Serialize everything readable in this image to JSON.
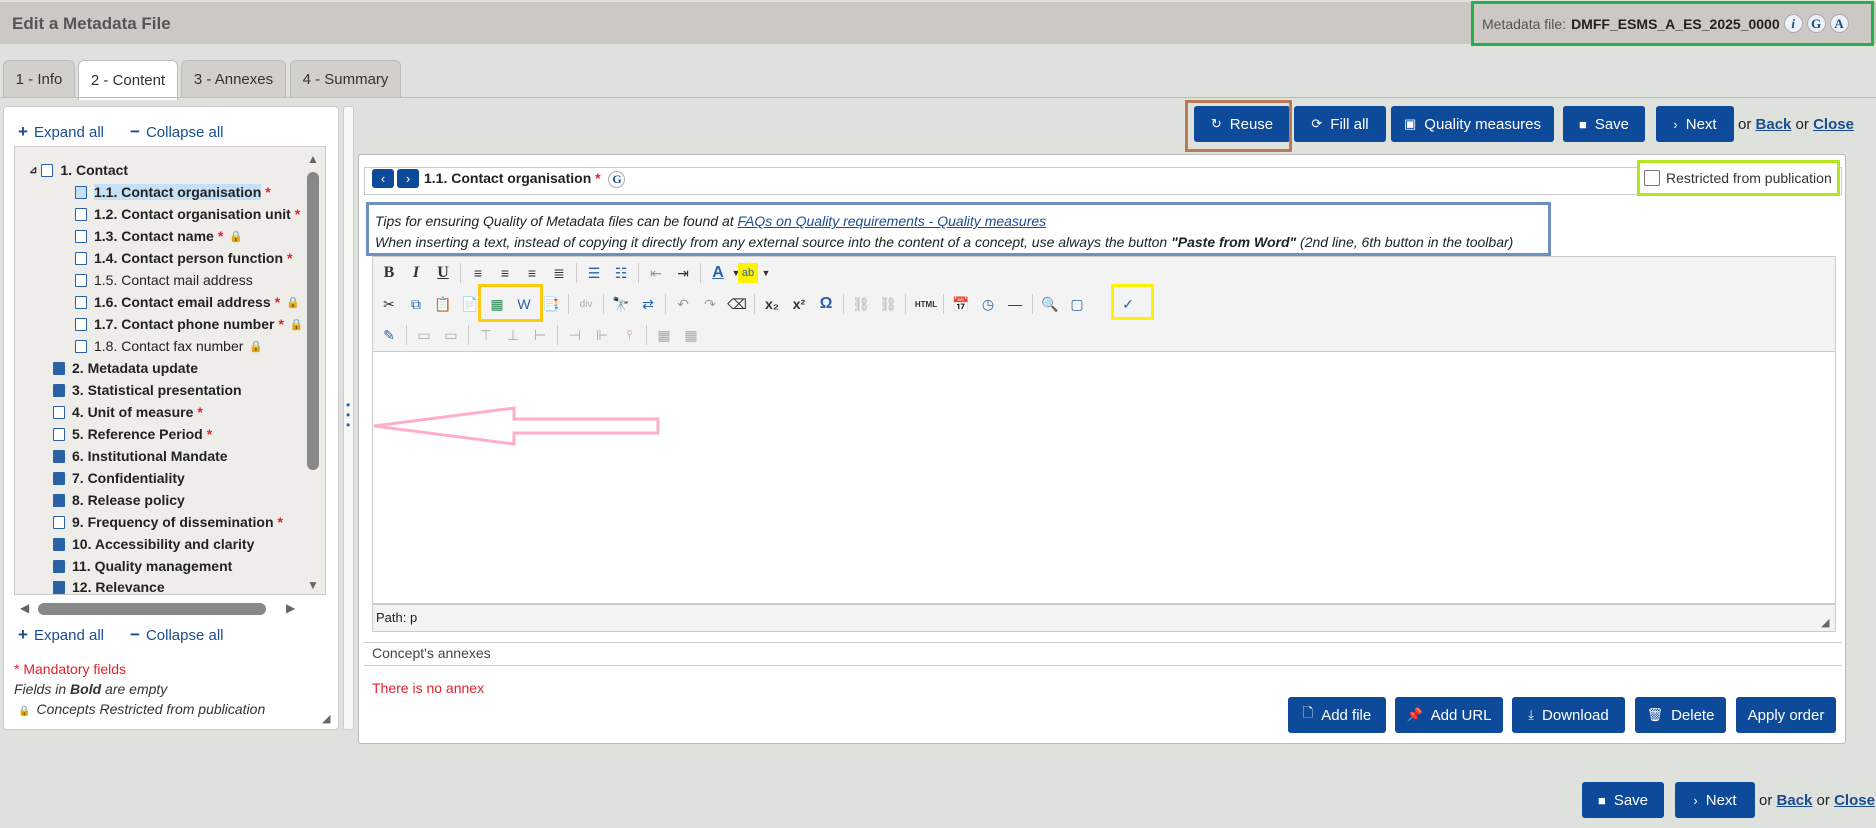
{
  "header": {
    "title": "Edit a Metadata File",
    "metadata_label": "Metadata file:",
    "metadata_value": "DMFF_ESMS_A_ES_2025_0000",
    "icons": [
      "info-icon",
      "g-icon",
      "a-icon"
    ],
    "icon_letters": {
      "info": "i",
      "g": "G",
      "a": "A"
    }
  },
  "tabs": [
    {
      "label": "1 - Info"
    },
    {
      "label": "2 - Content",
      "active": true
    },
    {
      "label": "3 - Annexes"
    },
    {
      "label": "4 - Summary"
    }
  ],
  "sidebar": {
    "expand_all": "Expand all",
    "collapse_all": "Collapse all",
    "tree": [
      {
        "label": "1. Contact",
        "bold": true,
        "type": "folder-open"
      },
      {
        "label": "1.1. Contact organisation",
        "bold": true,
        "type": "doc",
        "mandatory": true,
        "selected": true
      },
      {
        "label": "1.2. Contact organisation unit",
        "bold": true,
        "type": "doc",
        "mandatory": true
      },
      {
        "label": "1.3. Contact name",
        "bold": true,
        "type": "doc",
        "mandatory": true,
        "restricted": true
      },
      {
        "label": "1.4. Contact person function",
        "bold": true,
        "type": "doc",
        "mandatory": true
      },
      {
        "label": "1.5. Contact mail address",
        "bold": false,
        "type": "doc"
      },
      {
        "label": "1.6. Contact email address",
        "bold": true,
        "type": "doc",
        "mandatory": true,
        "restricted": true
      },
      {
        "label": "1.7. Contact phone number",
        "bold": true,
        "type": "doc",
        "mandatory": true,
        "restricted": true
      },
      {
        "label": "1.8. Contact fax number",
        "bold": false,
        "type": "doc",
        "restricted": true
      },
      {
        "label": "2. Metadata update",
        "bold": true,
        "type": "folder"
      },
      {
        "label": "3. Statistical presentation",
        "bold": true,
        "type": "folder"
      },
      {
        "label": "4. Unit of measure",
        "bold": true,
        "type": "doc",
        "mandatory": true
      },
      {
        "label": "5. Reference Period",
        "bold": true,
        "type": "doc",
        "mandatory": true
      },
      {
        "label": "6. Institutional Mandate",
        "bold": true,
        "type": "folder"
      },
      {
        "label": "7. Confidentiality",
        "bold": true,
        "type": "folder"
      },
      {
        "label": "8. Release policy",
        "bold": true,
        "type": "folder"
      },
      {
        "label": "9. Frequency of dissemination",
        "bold": true,
        "type": "doc",
        "mandatory": true
      },
      {
        "label": "10. Accessibility and clarity",
        "bold": true,
        "type": "folder"
      },
      {
        "label": "11. Quality management",
        "bold": true,
        "type": "folder"
      },
      {
        "label": "12. Relevance",
        "bold": true,
        "type": "folder"
      }
    ],
    "legend": {
      "mandatory": "* Mandatory fields",
      "bold_prefix": "Fields in ",
      "bold_word": "Bold",
      "bold_suffix": " are empty",
      "restricted": "Concepts Restricted from publication"
    }
  },
  "actions": {
    "reuse": "Reuse",
    "fill_all": "Fill all",
    "quality_measures": "Quality measures",
    "save": "Save",
    "next": "Next",
    "or1": "or",
    "back": "Back",
    "or2": "or",
    "close": "Close"
  },
  "concept": {
    "title": "1.1. Contact organisation",
    "mandatory_mark": "*",
    "g_letter": "G",
    "restricted_label": "Restricted from publication"
  },
  "tips": {
    "line1_prefix": "Tips for ensuring Quality of Metadata files can be found at ",
    "line1_link": "FAQs on Quality requirements - Quality measures",
    "line2_prefix": "When inserting a text, instead of copying it directly from any external source into the content of a concept, use always the button ",
    "line2_bold": "\"Paste from Word\"",
    "line2_suffix": " (2nd line, 6th button in the toolbar)"
  },
  "editor": {
    "path": "Path: p",
    "glyphs": {
      "bold": "B",
      "italic": "I",
      "underline": "U",
      "font_color": "A",
      "subscript": "x₂",
      "superscript": "x²",
      "omega": "Ω",
      "html": "HTML"
    }
  },
  "annexes": {
    "label": "Concept's annexes",
    "empty": "There is no annex",
    "add_file": "Add file",
    "add_url": "Add URL",
    "download": "Download",
    "delete": "Delete",
    "apply_order": "Apply order"
  },
  "colors": {
    "accent": "#0e4a9a",
    "mandatory": "#e2222d",
    "highlight_green": "#22b14c",
    "highlight_brown": "#b97a57",
    "highlight_lime": "#b5e61d",
    "highlight_blue": "#6f8fc0",
    "highlight_orange": "#ffc90e",
    "highlight_yellow": "#fff200",
    "arrow_pink": "#ffaec9"
  }
}
